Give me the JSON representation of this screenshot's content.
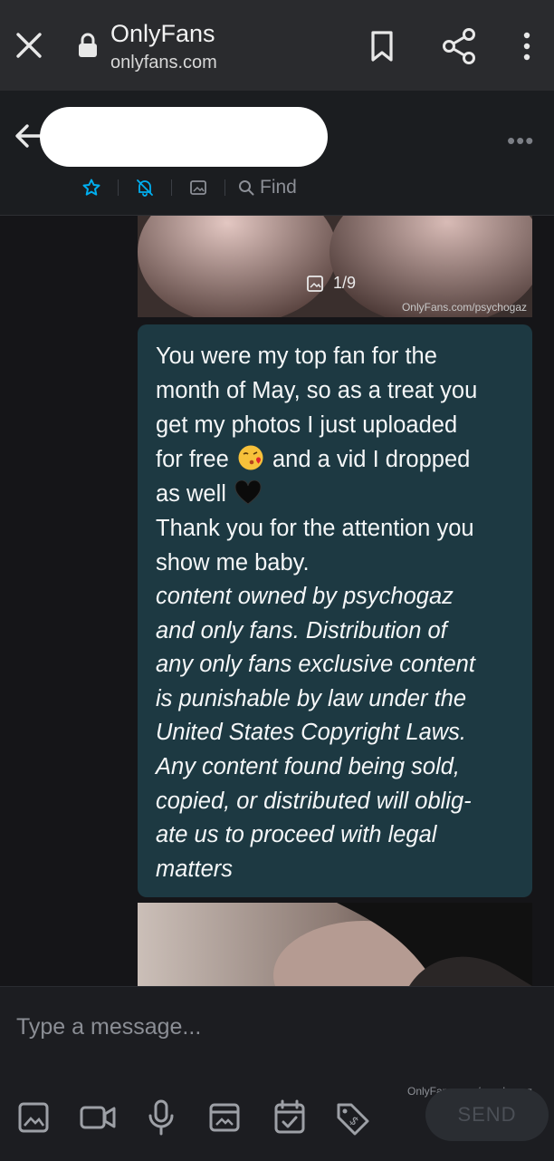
{
  "browser": {
    "title": "OnlyFans",
    "url": "onlyfans.com",
    "icons": [
      "close-icon",
      "lock-icon",
      "bookmark-icon",
      "share-icon",
      "more-vertical-icon"
    ]
  },
  "chat_header": {
    "back_icon": "arrow-left-icon",
    "contact_name": "",
    "menu_icon": "more-horizontal-icon",
    "tools": [
      "star-icon",
      "bell-off-icon",
      "image-icon"
    ],
    "find_label": "Find"
  },
  "media_top": {
    "counter": "1/9",
    "watermark": "OnlyFans.com/psychogaz"
  },
  "message": {
    "line1": "You were my top fan for the",
    "line2": "month of May, so as a treat you",
    "line3": "get my photos I just uploaded",
    "line4a": "for free",
    "line4b": "and a vid I dropped",
    "line5": "as well",
    "line6": "Thank you for the attention you",
    "line7": "show me baby.",
    "italic": [
      "content owned by psychogaz",
      "and only fans. Distribution of",
      "any only fans exclusive content",
      "is punishable by law under the",
      "United States Copyright Laws.",
      "Any content found being sold,",
      "copied, or distributed will oblig-",
      "ate us to proceed with legal",
      "matters"
    ],
    "emoji1": "kiss-face-emoji",
    "emoji2": "black-heart-emoji"
  },
  "composer": {
    "placeholder": "Type a message...",
    "watermark": "OnlyFans.com/psychogaz",
    "tools": [
      "image-icon",
      "video-icon",
      "microphone-icon",
      "vault-icon",
      "calendar-icon",
      "price-tag-icon"
    ],
    "send_label": "SEND"
  },
  "colors": {
    "bubble": "#1d3942",
    "accent": "#00aff0",
    "background": "#151518"
  }
}
